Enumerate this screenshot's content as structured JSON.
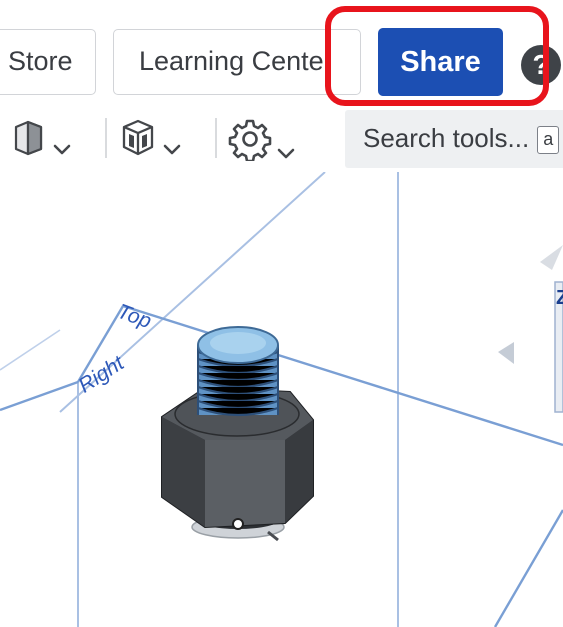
{
  "header": {
    "store_label": "Store",
    "learning_center_label": "Learning Cente",
    "share_label": "Share",
    "help_glyph": "?"
  },
  "toolbar": {
    "tools": [
      {
        "icon": "view-cube-icon",
        "has_dropdown": true
      },
      {
        "icon": "display-mode-icon",
        "has_dropdown": true
      },
      {
        "icon": "gear-icon",
        "has_dropdown": true
      }
    ],
    "search_placeholder": "Search tools...",
    "search_shortcut": "a"
  },
  "viewport": {
    "plane_top_label": "Top",
    "plane_right_label": "Right",
    "axis_label": "Z"
  },
  "colors": {
    "share_button": "#1c4fb3",
    "highlight": "#e8141c",
    "plane_line": "#7a9fd4",
    "plane_label": "#2d58b8",
    "part_dark": "#45484c",
    "part_thread": "#7fb3dd"
  }
}
